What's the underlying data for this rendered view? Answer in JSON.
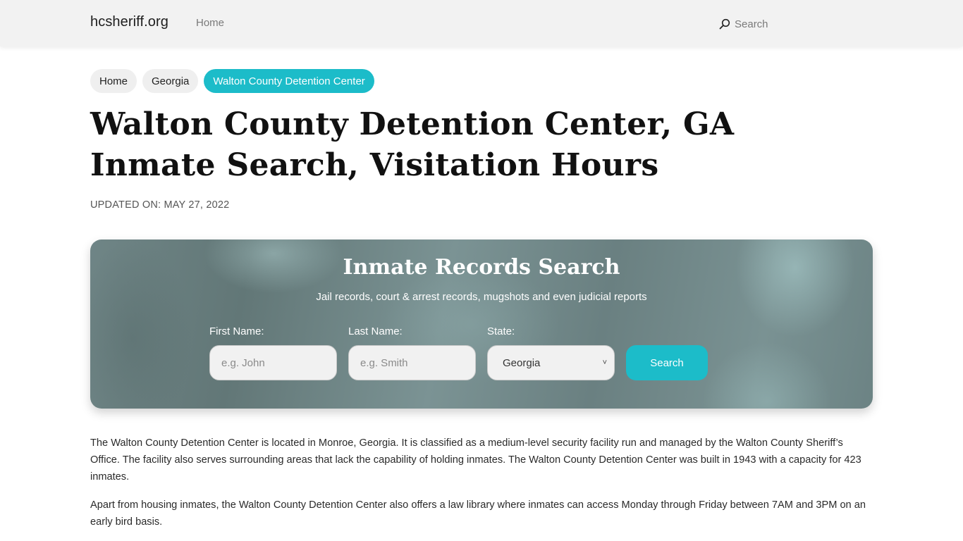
{
  "header": {
    "brand": "hcsheriff.org",
    "nav": [
      {
        "label": "Home"
      }
    ],
    "search": {
      "label": "Search",
      "icon": "search-icon"
    }
  },
  "breadcrumbs": [
    {
      "label": "Home",
      "active": false
    },
    {
      "label": "Georgia",
      "active": false
    },
    {
      "label": "Walton County Detention Center",
      "active": true
    }
  ],
  "page": {
    "title": "Walton County Detention Center, GA Inmate Search, Visitation Hours",
    "updated": "UPDATED ON: MAY 27, 2022"
  },
  "search_panel": {
    "title": "Inmate Records Search",
    "subtitle": "Jail records, court & arrest records, mugshots and even judicial reports",
    "first_name": {
      "label": "First Name:",
      "placeholder": "e.g. John",
      "value": ""
    },
    "last_name": {
      "label": "Last Name:",
      "placeholder": "e.g. Smith",
      "value": ""
    },
    "state": {
      "label": "State:",
      "selected": "Georgia"
    },
    "button_label": "Search"
  },
  "content": {
    "paragraphs": [
      "The Walton County Detention Center is located in Monroe, Georgia. It is classified as a medium-level security facility run and managed by the Walton County Sheriff’s Office. The facility also serves surrounding areas that lack the capability of holding inmates. The Walton County Detention Center was built in 1943 with a capacity for 423 inmates.",
      "Apart from housing inmates, the Walton County Detention Center also offers a law library where inmates can access Monday through Friday between 7AM and 3PM on an early bird basis."
    ]
  },
  "colors": {
    "accent": "#1cbcc9",
    "header_bg": "#f2f2f2",
    "pill_bg": "#efefef"
  }
}
